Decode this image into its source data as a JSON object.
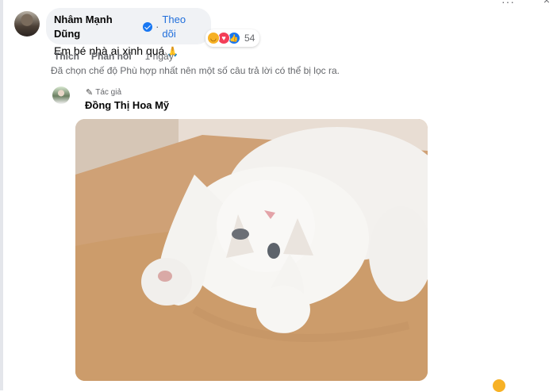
{
  "comment": {
    "author": "Nhâm Mạnh Dũng",
    "follow_label": "Theo dõi",
    "separator": "·",
    "text": "Em bé nhà ai xinh quá",
    "reaction_count": "54",
    "actions": {
      "like": "Thích",
      "reply": "Phản hồi",
      "time": "1 ngày"
    }
  },
  "filter_note": "Đã chọn chế độ Phù hợp nhất nên một số câu trả lời có thể bị lọc ra.",
  "reply": {
    "badge": "Tác giả",
    "author": "Đồng Thị Hoa Mỹ"
  },
  "colors": {
    "bubble_bg": "#f0f2f5",
    "link_blue": "#216fdb",
    "verified_blue": "#1877f2",
    "secondary_text": "#65676b"
  },
  "icons": [
    "verified-badge-icon",
    "clapping-hands-icon",
    "haha-reaction-icon",
    "love-reaction-icon",
    "like-reaction-icon",
    "pencil-icon"
  ]
}
